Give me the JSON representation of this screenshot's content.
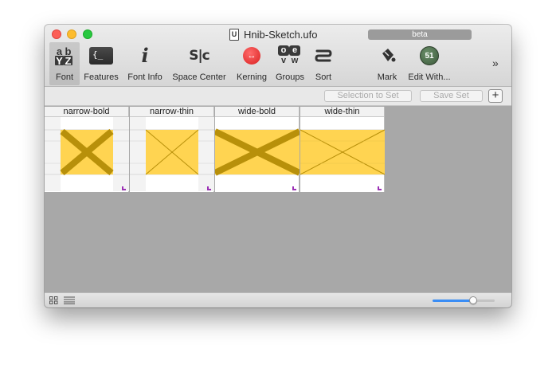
{
  "window": {
    "title": "Hnib-Sketch.ufo",
    "badge": "beta",
    "doc_icon_letter": "U"
  },
  "toolbar": {
    "items": [
      {
        "label": "Font",
        "icon": "font-grid-icon"
      },
      {
        "label": "Features",
        "icon": "features-braces-icon",
        "glyph": "{_"
      },
      {
        "label": "Font Info",
        "icon": "info-icon",
        "glyph": "i"
      },
      {
        "label": "Space Center",
        "icon": "space-center-icon",
        "glyph": "S|c"
      },
      {
        "label": "Kerning",
        "icon": "kerning-icon"
      },
      {
        "label": "Groups",
        "icon": "groups-icon"
      },
      {
        "label": "Sort",
        "icon": "sort-icon"
      },
      {
        "label": "Mark",
        "icon": "paint-bucket-icon"
      },
      {
        "label": "Edit With...",
        "icon": "edit-with-icon",
        "glyph": "51"
      }
    ],
    "font_icon_letters": [
      "a",
      "b",
      "Y",
      "Z"
    ],
    "groups_icon_letters": [
      "o",
      "e",
      "v",
      "w"
    ],
    "overflow": "»"
  },
  "setbar": {
    "selection_to_set": "Selection to Set",
    "save_set": "Save Set",
    "add": "+"
  },
  "glyphs": [
    {
      "name": "narrow-bold"
    },
    {
      "name": "narrow-thin"
    },
    {
      "name": "wide-bold"
    },
    {
      "name": "wide-thin"
    }
  ],
  "colors": {
    "glyph_fill": "#ffd451",
    "glyph_stroke": "#b8900a",
    "mark": "#9b30b5",
    "slider": "#3a8df5"
  },
  "zoom_slider": {
    "fraction": 0.66
  }
}
